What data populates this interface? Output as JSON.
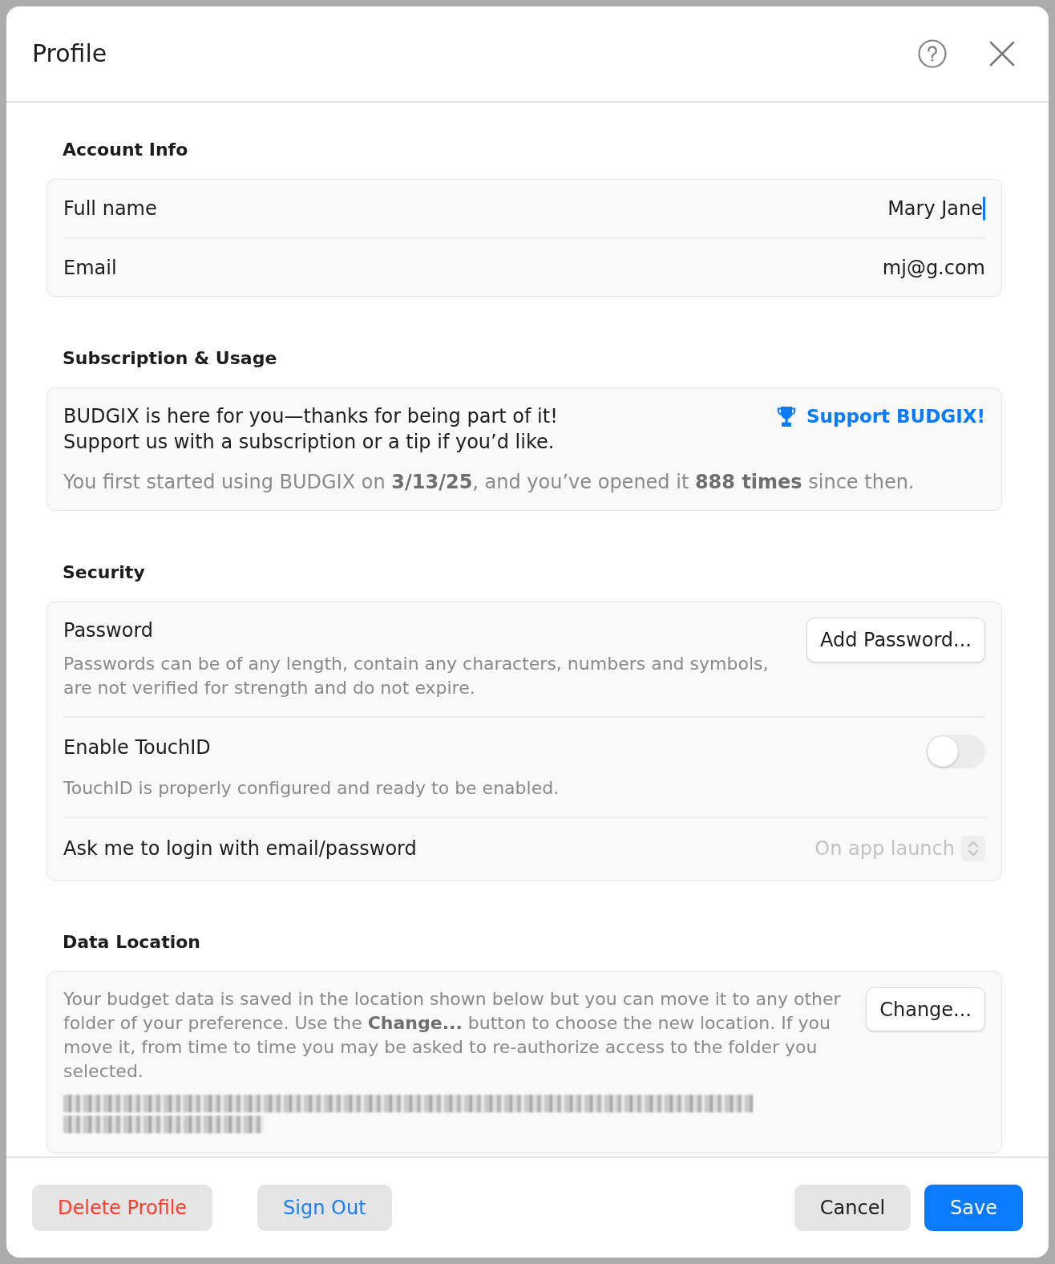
{
  "window": {
    "title": "Profile"
  },
  "sections": [
    {
      "kind": "fields",
      "title": "Account Info",
      "rows": [
        {
          "label": "Full name",
          "value": "Mary Jane",
          "focused": true
        },
        {
          "label": "Email",
          "value": "mj@g.com",
          "focused": false
        }
      ]
    },
    {
      "kind": "subscription",
      "title": "Subscription & Usage",
      "message": "BUDGIX is here for you—thanks for being part of it!\nSupport us with a subscription or a tip if you’d like.",
      "link": "Support BUDGIX!",
      "usage": "You first started using BUDGIX on **3/13/25**, and you’ve opened it **888 times** since then."
    },
    {
      "kind": "settings",
      "title": "Security",
      "rows": [
        {
          "kind": "button",
          "label": "Password",
          "description": "Passwords can be of any length, contain any characters, numbers and symbols, are not verified for strength and do not expire.",
          "button": "Add Password..."
        },
        {
          "kind": "toggle",
          "label": "Enable TouchID",
          "description": "TouchID is properly configured and ready to be enabled.",
          "on": false
        },
        {
          "kind": "select",
          "label": "Ask me to login with email/password",
          "value": "On app launch",
          "disabled": true
        }
      ]
    },
    {
      "kind": "location",
      "title": "Data Location",
      "description": "Your budget data is saved in the location shown below but you can move it to any other folder of your preference. Use the **Change...** button to choose the new location. If you move it, from time to time you may be asked to re-authorize access to the folder you selected.",
      "button": "Change...",
      "path_blurred": true
    }
  ],
  "footer": {
    "left_buttons": [
      {
        "kind": "destructive",
        "label": "Delete Profile"
      },
      {
        "kind": "secondary",
        "label": "Sign Out"
      }
    ],
    "right_buttons": [
      {
        "kind": "cancel",
        "label": "Cancel"
      },
      {
        "kind": "primary",
        "label": "Save"
      }
    ]
  }
}
